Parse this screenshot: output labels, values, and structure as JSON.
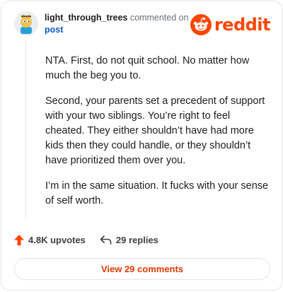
{
  "header": {
    "username": "light_through_trees",
    "commented_on": "commented on",
    "post_link": "post",
    "logo_text": "reddit"
  },
  "comment": {
    "paragraphs": [
      "NTA. First, do not quit school. No matter how much the beg you to.",
      "Second, your parents set a precedent of support with your two siblings. You’re right to feel cheated. They either shouldn’t have had more kids then they could handle, or they shouldn’t have prioritized them over you.",
      "I’m in the same situation. It fucks with your sense of self worth."
    ]
  },
  "actions": {
    "upvotes": "4.8K upvotes",
    "replies": "29 replies"
  },
  "footer": {
    "view_comments": "View 29 comments"
  },
  "colors": {
    "brand": "#ff4500",
    "link": "#0f5dbd",
    "view_button_text": "#d93a00"
  },
  "icons": [
    "avatar-icon",
    "reddit-snoo-icon",
    "upvote-arrow-icon",
    "reply-arrow-icon"
  ]
}
